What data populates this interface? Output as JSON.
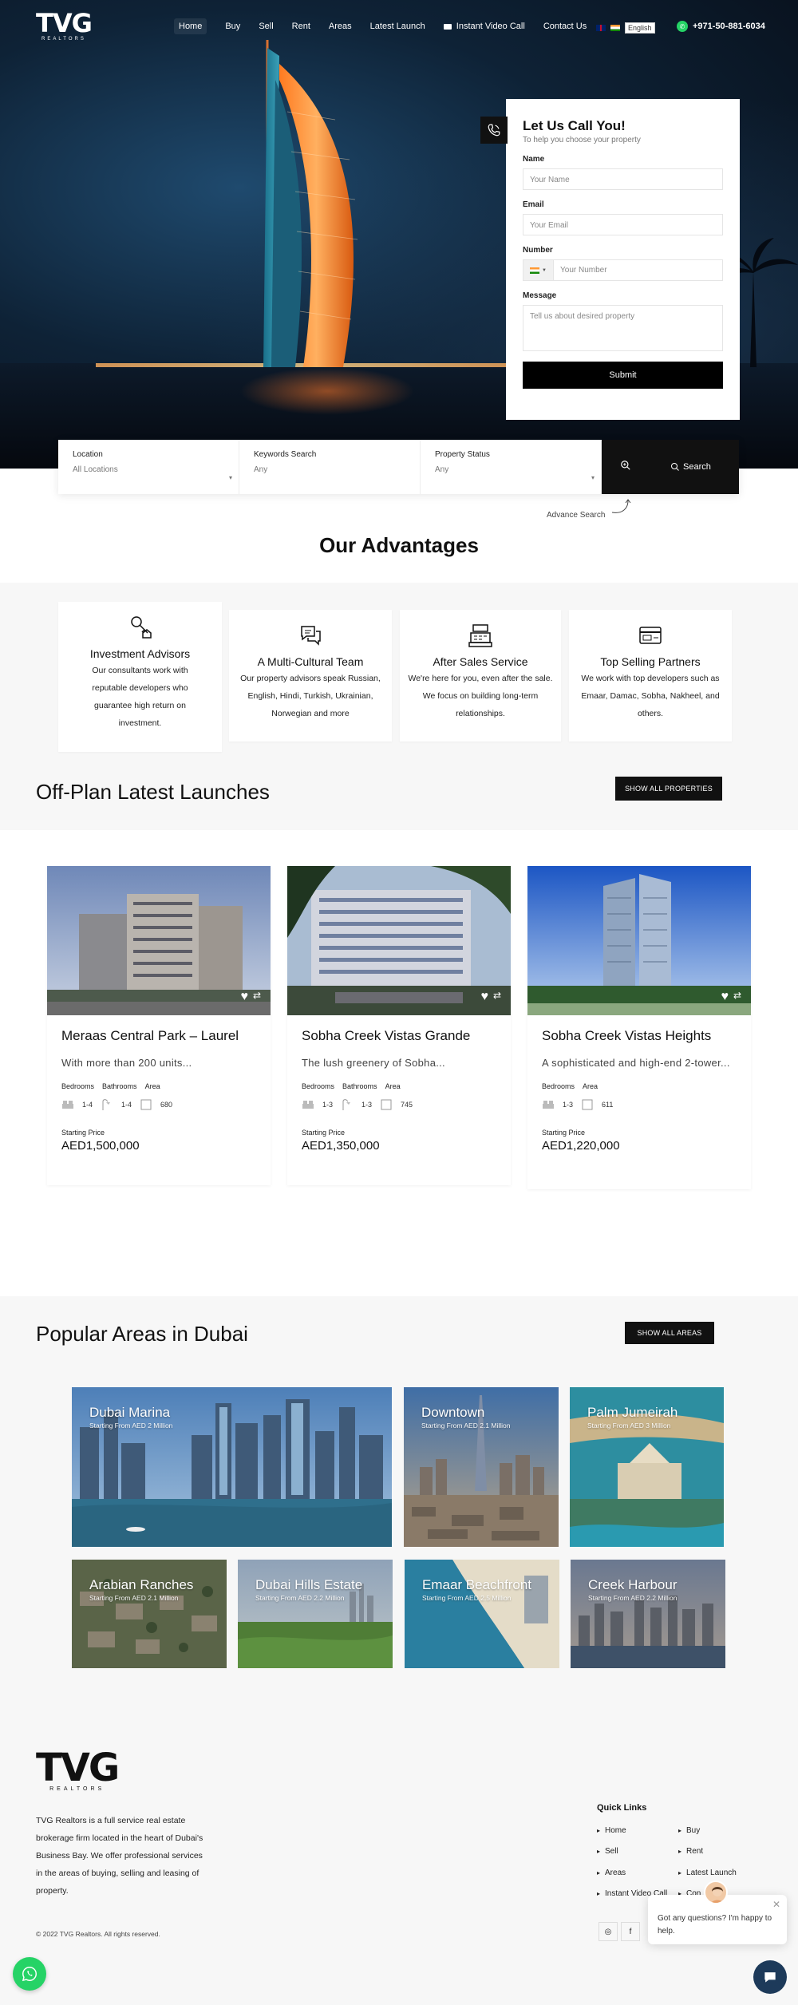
{
  "brand": {
    "logo_text": "TVG",
    "logo_sub": "REALTORS"
  },
  "nav": {
    "links": [
      "Home",
      "Buy",
      "Sell",
      "Rent",
      "Areas",
      "Latest Launch",
      "Instant Video Call",
      "Contact Us"
    ],
    "language": "English",
    "phone": "+971-50-881-6034"
  },
  "call_form": {
    "title": "Let Us Call You!",
    "subtitle": "To help you choose your property",
    "name_label": "Name",
    "name_placeholder": "Your Name",
    "email_label": "Email",
    "email_placeholder": "Your Email",
    "number_label": "Number",
    "number_placeholder": "Your Number",
    "message_label": "Message",
    "message_placeholder": "Tell us about desired property",
    "submit": "Submit"
  },
  "search": {
    "location_label": "Location",
    "location_value": "All Locations",
    "keywords_label": "Keywords Search",
    "keywords_value": "Any",
    "status_label": "Property Status",
    "status_value": "Any",
    "button": "Search",
    "advance": "Advance Search"
  },
  "advantages": {
    "title": "Our Advantages",
    "items": [
      {
        "icon": "key-house-icon",
        "title": "Investment Advisors",
        "text": "Our consultants work with reputable developers who guarantee high return on investment."
      },
      {
        "icon": "chat-bubbles-icon",
        "title": "A Multi-Cultural Team",
        "text": "Our property advisors speak Russian, English, Hindi, Turkish, Ukrainian, Norwegian and more"
      },
      {
        "icon": "cash-register-icon",
        "title": "After Sales Service",
        "text": "We're here for you, even after the sale. We focus on building long-term relationships."
      },
      {
        "icon": "credit-card-icon",
        "title": "Top Selling Partners",
        "text": "We work with top developers such as Emaar, Damac, Sobha, Nakheel, and others."
      }
    ]
  },
  "offplan": {
    "title": "Off-Plan Latest Launches",
    "button": "SHOW ALL PROPERTIES",
    "bedrooms_label": "Bedrooms",
    "bathrooms_label": "Bathrooms",
    "area_label": "Area",
    "price_label": "Starting Price",
    "properties": [
      {
        "name": "Meraas Central Park – Laurel",
        "desc": "With more than 200 units...",
        "bedrooms": "1-4",
        "bathrooms": "1-4",
        "area": "680",
        "price": "AED1,500,000"
      },
      {
        "name": "Sobha Creek Vistas Grande",
        "desc": "The lush greenery of Sobha...",
        "bedrooms": "1-3",
        "bathrooms": "1-3",
        "area": "745",
        "price": "AED1,350,000"
      },
      {
        "name": "Sobha Creek Vistas Heights",
        "desc": "A sophisticated and high-end 2-tower...",
        "bedrooms": "1-3",
        "area": "611",
        "price": "AED1,220,000"
      }
    ]
  },
  "areas": {
    "title": "Popular Areas in Dubai",
    "button": "SHOW ALL AREAS",
    "items": [
      {
        "name": "Dubai Marina",
        "from": "Starting From AED 2 Million"
      },
      {
        "name": "Downtown",
        "from": "Starting From AED 2.1 Million"
      },
      {
        "name": "Palm Jumeirah",
        "from": "Starting From AED 3 Million"
      },
      {
        "name": "Arabian Ranches",
        "from": "Starting From AED 2.1 Million"
      },
      {
        "name": "Dubai Hills Estate",
        "from": "Starting From AED 2.2 Million"
      },
      {
        "name": "Emaar Beachfront",
        "from": "Starting From AED 2.5 Million"
      },
      {
        "name": "Creek Harbour",
        "from": "Starting From AED 2.2 Million"
      }
    ]
  },
  "footer": {
    "about": "TVG Realtors is a full service real estate brokerage firm located in the heart of Dubai's Business Bay. We offer professional services in the areas of buying, selling and leasing of property.",
    "copyright": "© 2022 TVG Realtors. All rights reserved.",
    "quick_links_title": "Quick Links",
    "quick_links": [
      "Home",
      "Buy",
      "Sell",
      "Rent",
      "Areas",
      "Latest Launch",
      "Instant Video Call",
      "Contact Us"
    ],
    "quick_links_visible": [
      "Home",
      "Buy",
      "Sell",
      "Rent",
      "Areas",
      "Latest Launch",
      "Instant Video Call",
      "Con"
    ]
  },
  "chat": {
    "message": "Got any questions? I'm happy to help."
  }
}
